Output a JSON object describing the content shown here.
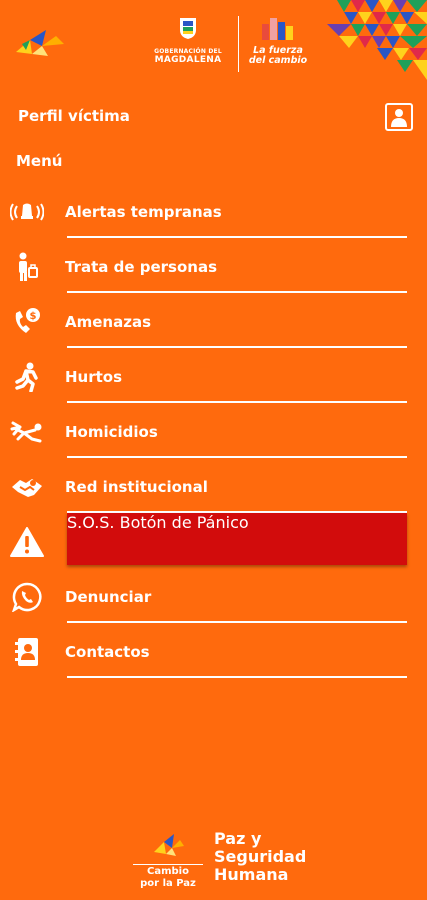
{
  "header": {
    "gov_small": "GOBERNACIÓN DEL",
    "gov_big": "MAGDALENA",
    "fuerza_line1": "La fuerza",
    "fuerza_line2": "del cambio"
  },
  "profile": {
    "label": "Perfil víctima",
    "icon": "user-icon"
  },
  "menu_title": "Menú",
  "menu": [
    {
      "label": "Alertas tempranas",
      "icon": "alarm-icon"
    },
    {
      "label": "Trata de personas",
      "icon": "person-bag-icon"
    },
    {
      "label": "Amenazas",
      "icon": "phone-money-icon"
    },
    {
      "label": "Hurtos",
      "icon": "running-person-icon"
    },
    {
      "label": "Homicidios",
      "icon": "fallen-person-icon"
    },
    {
      "label": "Red institucional",
      "icon": "handshake-icon"
    },
    {
      "label": "S.O.S. Botón de Pánico",
      "icon": "warning-icon",
      "highlight": "#d20c0c"
    },
    {
      "label": "Denunciar",
      "icon": "whatsapp-icon"
    },
    {
      "label": "Contactos",
      "icon": "contacts-book-icon"
    }
  ],
  "footer": {
    "cambio_line1": "Cambio",
    "cambio_line2": "por la Paz",
    "paz_line1": "Paz y",
    "paz_line2": "Seguridad",
    "paz_line3": "Humana"
  },
  "colors": {
    "background": "#ff6a0d",
    "panic": "#d20c0c",
    "text": "#ffffff"
  }
}
